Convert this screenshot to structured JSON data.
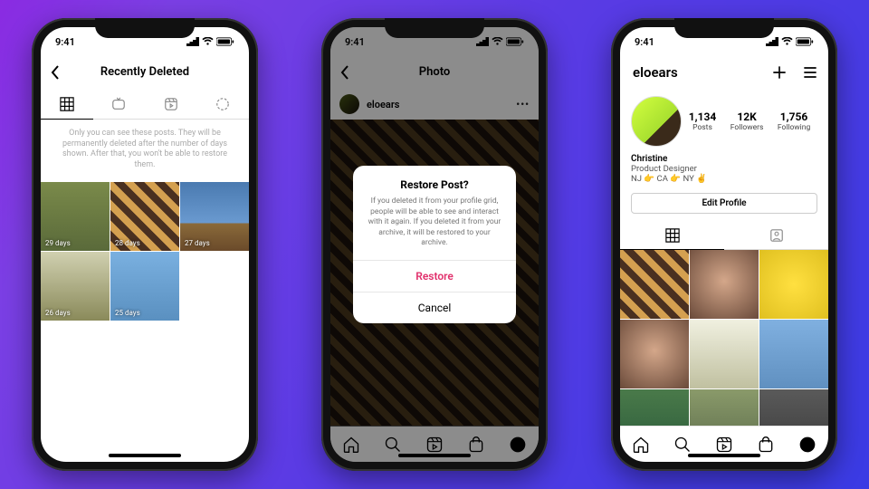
{
  "status": {
    "time": "9:41"
  },
  "phone1": {
    "title": "Recently Deleted",
    "info": "Only you can see these posts. They will be permanently deleted after the number of days shown. After that, you won't be able to restore them.",
    "items": [
      {
        "days": "29 days"
      },
      {
        "days": "28 days"
      },
      {
        "days": "27 days"
      },
      {
        "days": "26 days"
      },
      {
        "days": "25 days"
      }
    ]
  },
  "phone2": {
    "title": "Photo",
    "username": "eloears",
    "modal": {
      "title": "Restore Post?",
      "body": "If you deleted it from your profile grid, people will be able to see and interact with it again. If you deleted it from your archive, it will be restored to your archive.",
      "restore": "Restore",
      "cancel": "Cancel"
    }
  },
  "phone3": {
    "username": "eloears",
    "stats": {
      "posts_n": "1,134",
      "posts_l": "Posts",
      "followers_n": "12K",
      "followers_l": "Followers",
      "following_n": "1,756",
      "following_l": "Following"
    },
    "bio": {
      "name": "Christine",
      "role": "Product Designer",
      "loc": "NJ 👉 CA 👉 NY ✌️"
    },
    "edit": "Edit Profile"
  }
}
